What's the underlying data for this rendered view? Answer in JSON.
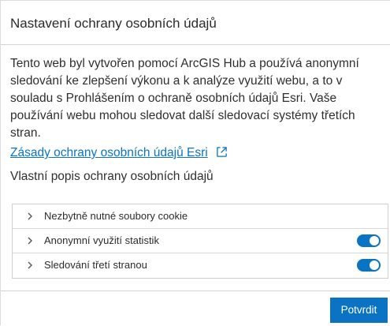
{
  "dialog": {
    "title": "Nastavení ochrany osobních údajů",
    "description": "Tento web byl vytvořen pomocí ArcGIS Hub a používá anonymní sledování ke zlepšení výkonu a k analýze využití webu, a to v souladu s Prohlášením o ochraně osobních údajů Esri. Vaše používání webu mohou sledovat další sledovací systémy třetích stran.",
    "policy_link": "Zásady ochrany osobních údajů Esri",
    "policy_link_icon": "external-link-icon",
    "custom_description": "Vlastní popis ochrany osobních údajů"
  },
  "settings": [
    {
      "label": "Nezbytně nutné soubory cookie",
      "has_toggle": false
    },
    {
      "label": "Anonymní využití statistik",
      "has_toggle": true,
      "enabled": true
    },
    {
      "label": "Sledování třetí stranou",
      "has_toggle": true,
      "enabled": true
    }
  ],
  "footer": {
    "confirm_label": "Potvrdit"
  },
  "colors": {
    "accent": "#0a73c4",
    "link": "#0b74c4",
    "border": "#d4d4d4",
    "text": "#2b2b2b"
  }
}
